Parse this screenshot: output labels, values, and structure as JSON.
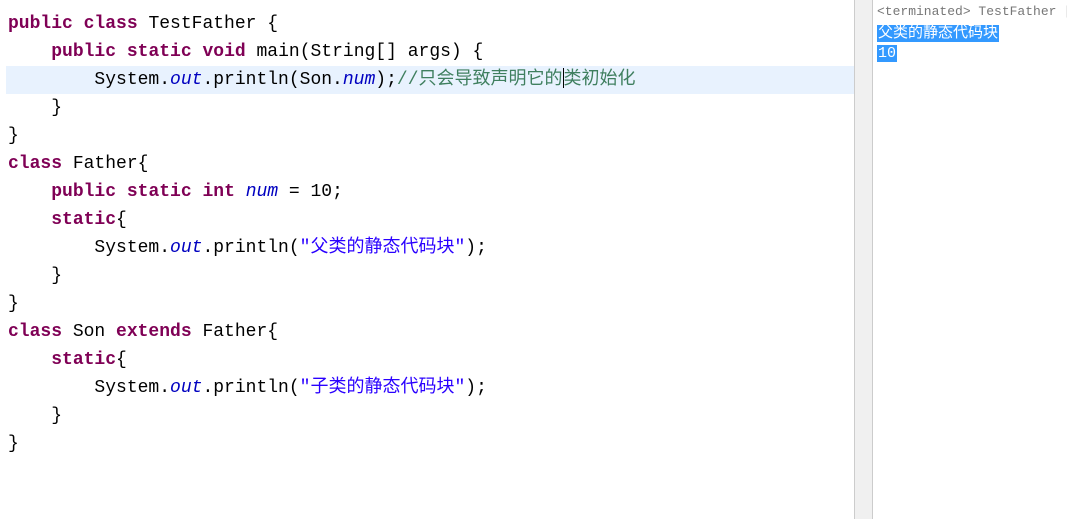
{
  "code": {
    "l1_public": "public",
    "l1_class": "class",
    "l1_name": " TestFather {",
    "l2_i": "    ",
    "l2_public": "public",
    "l2_static": "static",
    "l2_void": "void",
    "l2_main": " main(String[] args) {",
    "l3_i": "        System.",
    "l3_out": "out",
    "l3_print": ".println(Son.",
    "l3_num": "num",
    "l3_close": ");",
    "l3_cmt1": "//",
    "l3_cmt2": "只会导致声明它的",
    "l3_cmt3": "类初始化",
    "l4": "    }",
    "l5": "}",
    "l6_class": "class",
    "l6_rest": " Father{",
    "l7_i": "    ",
    "l7_public": "public",
    "l7_static": "static",
    "l7_int": "int",
    "l7_sp": " ",
    "l7_num": "num",
    "l7_rest": " = 10;",
    "l8_i": "    ",
    "l8_static": "static",
    "l8_br": "{",
    "l9_i": "        System.",
    "l9_out": "out",
    "l9_print": ".println(",
    "l9_str": "\"父类的静态代码块\"",
    "l9_close": ");",
    "l10": "    }",
    "l11": "}",
    "l12_class": "class",
    "l12_son": " Son ",
    "l12_extends": "extends",
    "l12_rest": " Father{",
    "l13_i": "    ",
    "l13_static": "static",
    "l13_br": "{",
    "l14_i": "        System.",
    "l14_out": "out",
    "l14_print": ".println(",
    "l14_str": "\"子类的静态代码块\"",
    "l14_close": ");",
    "l15": "    }",
    "l16": "}"
  },
  "console": {
    "header": "<terminated> TestFather [.",
    "line1": "父类的静态代码块",
    "line2": "10"
  }
}
